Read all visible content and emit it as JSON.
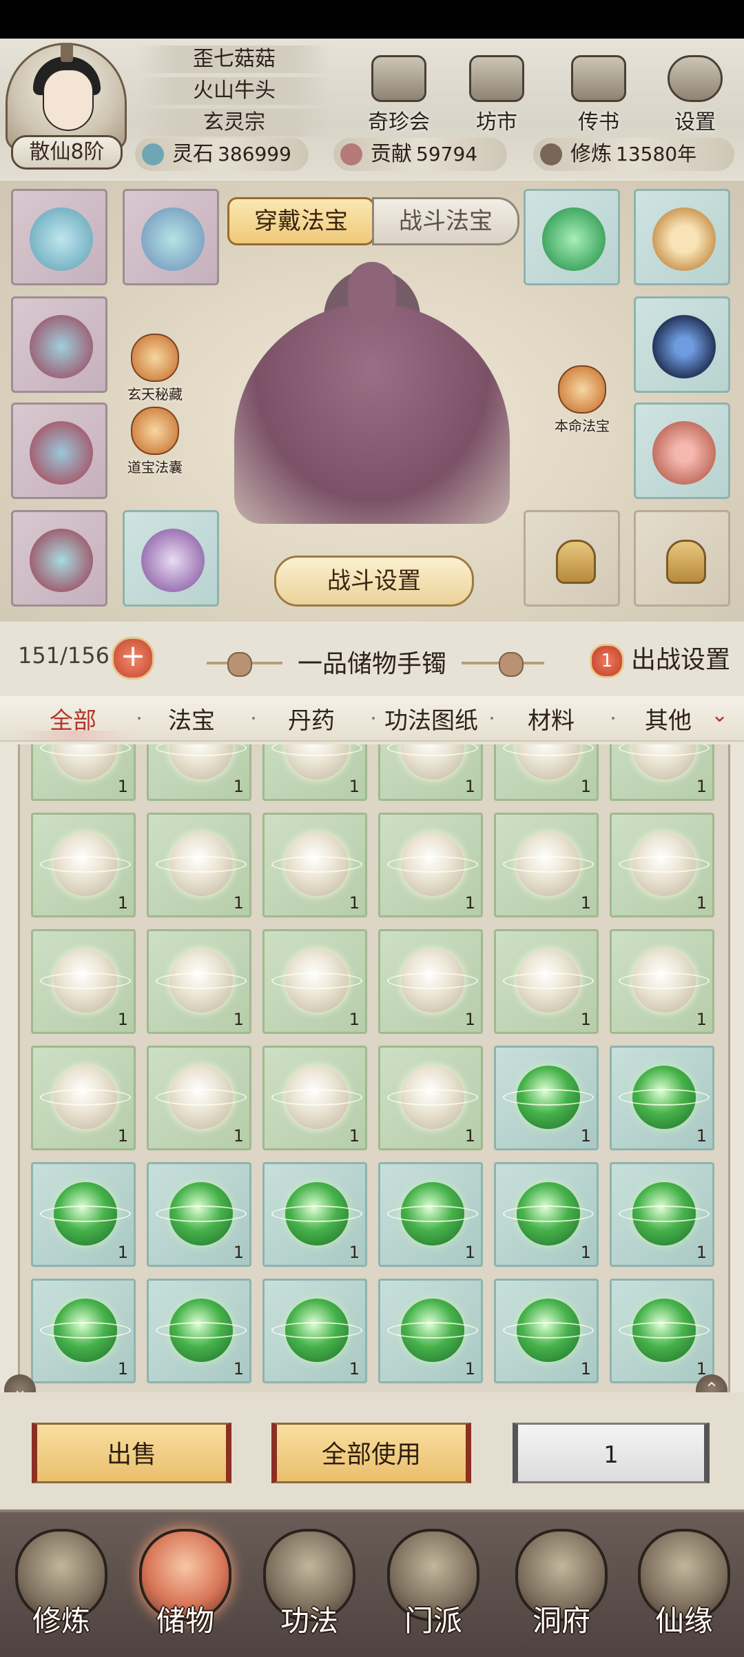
{
  "player": {
    "name": "歪七菇菇",
    "title": "火山牛头",
    "sect": "玄灵宗",
    "rank": "散仙8阶"
  },
  "top_nav": [
    {
      "label": "奇珍会",
      "icon": "treasure-pavilion-icon"
    },
    {
      "label": "坊市",
      "icon": "market-icon"
    },
    {
      "label": "传书",
      "icon": "letter-scroll-icon"
    },
    {
      "label": "设置",
      "icon": "gear-icon"
    }
  ],
  "resources": {
    "spirit_stone": {
      "label": "灵石",
      "value": "386999"
    },
    "contribution": {
      "label": "贡献",
      "value": "59794"
    },
    "cultivation": {
      "label": "修炼",
      "value": "13580年"
    }
  },
  "equip_tabs": {
    "wear": "穿戴法宝",
    "battle": "战斗法宝"
  },
  "side_buttons": {
    "xuantian": "玄天秘藏",
    "daobao": "道宝法囊",
    "benming": "本命法宝"
  },
  "battle_settings": "战斗设置",
  "bag": {
    "capacity": "151/156",
    "add": "+",
    "title": "一品储物手镯",
    "deploy_count": "1",
    "deploy_label": "出战设置"
  },
  "categories": [
    "全部",
    "法宝",
    "丹药",
    "功法图纸",
    "材料",
    "其他"
  ],
  "active_category": "全部",
  "inventory_rows": [
    [
      "white",
      "white",
      "white",
      "white",
      "white",
      "white"
    ],
    [
      "white",
      "white",
      "white",
      "white",
      "white",
      "white"
    ],
    [
      "white",
      "white",
      "white",
      "white",
      "green",
      "green"
    ],
    [
      "green",
      "green",
      "green",
      "green",
      "green",
      "green"
    ],
    [
      "green",
      "green",
      "green",
      "green",
      "green",
      "green"
    ],
    [
      "green",
      "green",
      "green",
      "green",
      "green",
      "green"
    ]
  ],
  "item_count": "1",
  "actions": {
    "sell": "出售",
    "use_all": "全部使用",
    "quantity": "1"
  },
  "bottom_nav": [
    {
      "label": "修炼",
      "icon": "cultivation-icon"
    },
    {
      "label": "储物",
      "icon": "storage-bag-icon"
    },
    {
      "label": "功法",
      "icon": "scripture-icon"
    },
    {
      "label": "门派",
      "icon": "sect-gate-icon"
    },
    {
      "label": "洞府",
      "icon": "cave-mountain-icon"
    },
    {
      "label": "仙缘",
      "icon": "immortal-fate-icon"
    }
  ],
  "active_bottom": "储物",
  "colors": {
    "accent_red": "#b3362a",
    "gold": "#f0c97a"
  }
}
